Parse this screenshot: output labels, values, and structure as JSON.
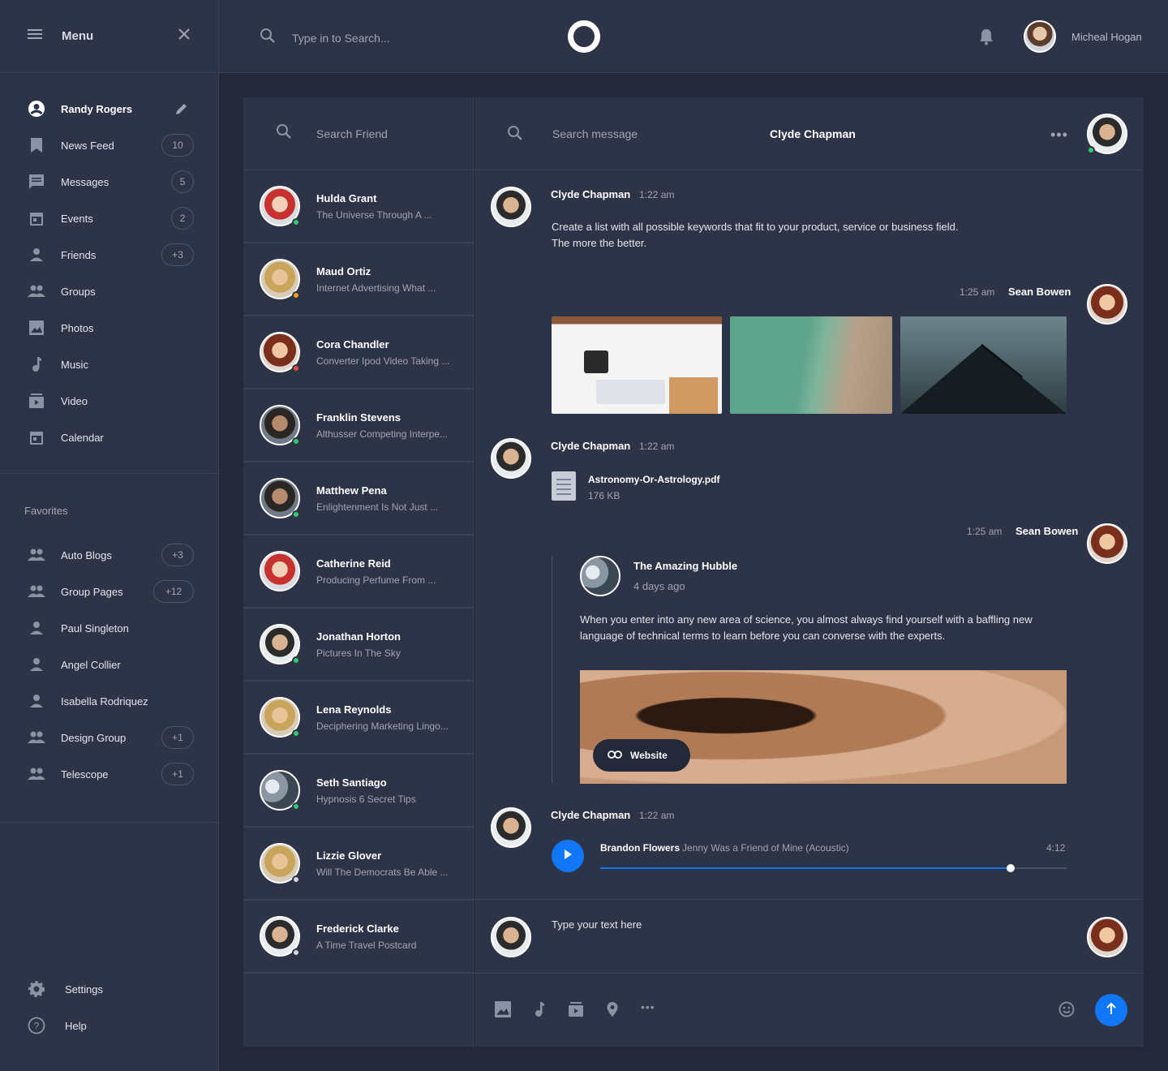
{
  "sidebar": {
    "menu_title": "Menu",
    "profile_name": "Randy Rogers",
    "items": [
      {
        "label": "News Feed",
        "badge": "10"
      },
      {
        "label": "Messages",
        "badge": "5"
      },
      {
        "label": "Events",
        "badge": "2"
      },
      {
        "label": "Friends",
        "badge": "+3"
      },
      {
        "label": "Groups"
      },
      {
        "label": "Photos"
      },
      {
        "label": "Music"
      },
      {
        "label": "Video"
      },
      {
        "label": "Calendar"
      }
    ],
    "favorites_title": "Favorites",
    "favorites": [
      {
        "label": "Auto Blogs",
        "badge": "+3"
      },
      {
        "label": "Group Pages",
        "badge": "+12"
      },
      {
        "label": "Paul Singleton"
      },
      {
        "label": "Angel Collier"
      },
      {
        "label": "Isabella Rodriquez"
      },
      {
        "label": "Design Group",
        "badge": "+1"
      },
      {
        "label": "Telescope",
        "badge": "+1"
      }
    ],
    "settings": "Settings",
    "help": "Help"
  },
  "topbar": {
    "search_placeholder": "Type in to Search...",
    "user_name": "Micheal Hogan"
  },
  "friends": {
    "search_placeholder": "Search Friend",
    "list": [
      {
        "name": "Hulda Grant",
        "preview": "The Universe Through A ...",
        "status": "online"
      },
      {
        "name": "Maud Ortiz",
        "preview": "Internet Advertising What ...",
        "status": "away"
      },
      {
        "name": "Cora Chandler",
        "preview": "Converter Ipod Video Taking ...",
        "status": "busy"
      },
      {
        "name": "Franklin Stevens",
        "preview": "Althusser Competing Interpe...",
        "status": "online"
      },
      {
        "name": "Matthew Pena",
        "preview": "Enlightenment Is Not Just ...",
        "status": "online"
      },
      {
        "name": "Catherine Reid",
        "preview": "Producing Perfume From ...",
        "status": "none"
      },
      {
        "name": "Jonathan Horton",
        "preview": "Pictures In The Sky",
        "status": "online"
      },
      {
        "name": "Lena Reynolds",
        "preview": "Deciphering Marketing Lingo...",
        "status": "online"
      },
      {
        "name": "Seth Santiago",
        "preview": "Hypnosis 6 Secret Tips",
        "status": "online"
      },
      {
        "name": "Lizzie Glover",
        "preview": "Will The Democrats Be Able ...",
        "status": "offline"
      },
      {
        "name": "Frederick Clarke",
        "preview": "A Time Travel Postcard",
        "status": "offline"
      }
    ]
  },
  "chat": {
    "search_placeholder": "Search message",
    "contact_name": "Clyde Chapman",
    "messages": {
      "m1": {
        "name": "Clyde Chapman",
        "time": "1:22 am",
        "line1": "Create a list with all possible keywords that fit to your product, service or business field.",
        "line2": "The more the better."
      },
      "m2": {
        "name": "Sean Bowen",
        "time": "1:25 am"
      },
      "m3": {
        "name": "Clyde Chapman",
        "time": "1:22 am",
        "file_name": "Astronomy-Or-Astrology.pdf",
        "file_size": "176 KB"
      },
      "m4": {
        "name": "Sean Bowen",
        "time": "1:25 am",
        "link_title": "The Amazing Hubble",
        "link_age": "4 days ago",
        "link_text1": "When you enter into any new area of science, you almost always find yourself with a baffling new",
        "link_text2": "language of technical terms to learn before you can converse with the experts.",
        "link_button": "Website"
      },
      "m5": {
        "name": "Clyde Chapman",
        "time": "1:22 am",
        "artist": "Brandon Flowers",
        "song": "Jenny Was a Friend of Mine (Acoustic)",
        "duration": "4:12",
        "progress": 0.88
      }
    },
    "compose_placeholder": "Type your text here"
  },
  "colors": {
    "accent": "#1277f7",
    "panel": "#2e3447",
    "background": "#232939",
    "online": "#2ecc71"
  }
}
